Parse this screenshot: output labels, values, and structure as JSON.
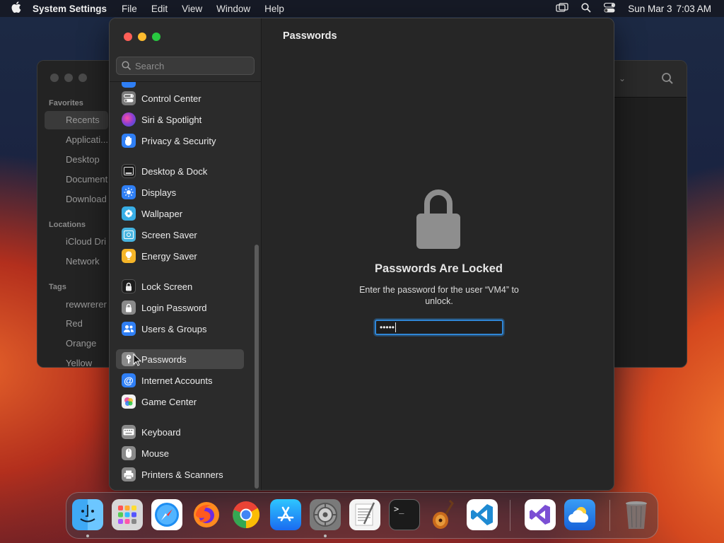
{
  "menubar": {
    "app_name": "System Settings",
    "menus": [
      "File",
      "Edit",
      "View",
      "Window",
      "Help"
    ],
    "date": "Sun Mar 3",
    "time": "7:03 AM"
  },
  "finder": {
    "sections": {
      "favorites": "Favorites",
      "locations": "Locations",
      "tags": "Tags"
    },
    "items": {
      "recents": "Recents",
      "applications": "Applicati...",
      "desktop": "Desktop",
      "documents": "Document",
      "downloads": "Download",
      "icloud": "iCloud Dri",
      "network": "Network",
      "tag1": "rewwrerer",
      "red": "Red",
      "orange": "Orange",
      "yellow": "Yellow"
    }
  },
  "settings": {
    "search": {
      "placeholder": "Search",
      "value": ""
    },
    "sidebar": [
      {
        "label": "Control Center",
        "icon": "control-center-icon",
        "color": "#7a7a7a"
      },
      {
        "label": "Siri & Spotlight",
        "icon": "siri-icon",
        "color": "#8b3fd1"
      },
      {
        "label": "Privacy & Security",
        "icon": "hand-icon",
        "color": "#2f7ff5"
      },
      {
        "label": "Desktop & Dock",
        "icon": "dock-icon",
        "color": "#1c1c1c"
      },
      {
        "label": "Displays",
        "icon": "sun-icon",
        "color": "#2f7ff5"
      },
      {
        "label": "Wallpaper",
        "icon": "flower-icon",
        "color": "#38aee6"
      },
      {
        "label": "Screen Saver",
        "icon": "screen-saver-icon",
        "color": "#47b4e0"
      },
      {
        "label": "Energy Saver",
        "icon": "bulb-icon",
        "color": "#f5b528"
      },
      {
        "label": "Lock Screen",
        "icon": "lock-icon",
        "color": "#1c1c1c"
      },
      {
        "label": "Login Password",
        "icon": "lock-icon",
        "color": "#8a8a8a"
      },
      {
        "label": "Users & Groups",
        "icon": "users-icon",
        "color": "#2f7ff5"
      },
      {
        "label": "Passwords",
        "icon": "key-icon",
        "color": "#8a8a8a"
      },
      {
        "label": "Internet Accounts",
        "icon": "at-icon",
        "color": "#2f7ff5"
      },
      {
        "label": "Game Center",
        "icon": "game-center-icon",
        "color": "#e8e8e8"
      },
      {
        "label": "Keyboard",
        "icon": "keyboard-icon",
        "color": "#8a8a8a"
      },
      {
        "label": "Mouse",
        "icon": "mouse-icon",
        "color": "#8a8a8a"
      },
      {
        "label": "Printers & Scanners",
        "icon": "printer-icon",
        "color": "#8a8a8a"
      }
    ],
    "selected": "Passwords",
    "main": {
      "title": "Passwords",
      "heading": "Passwords Are Locked",
      "message": "Enter the password for the user “VM4” to unlock.",
      "password_value": "•••••"
    }
  },
  "dock": [
    {
      "name": "Finder",
      "icon": "finder-icon",
      "running": true
    },
    {
      "name": "Launchpad",
      "icon": "launchpad-icon",
      "running": false
    },
    {
      "name": "Safari",
      "icon": "safari-icon",
      "running": false
    },
    {
      "name": "Firefox",
      "icon": "firefox-icon",
      "running": false
    },
    {
      "name": "Chrome",
      "icon": "chrome-icon",
      "running": false
    },
    {
      "name": "App Store",
      "icon": "app-store-icon",
      "running": false
    },
    {
      "name": "System Settings",
      "icon": "system-settings-icon",
      "running": true
    },
    {
      "name": "TextEdit",
      "icon": "textedit-icon",
      "running": false
    },
    {
      "name": "Terminal",
      "icon": "terminal-icon",
      "running": false
    },
    {
      "name": "GarageBand",
      "icon": "garageband-icon",
      "running": false
    },
    {
      "name": "Visual Studio Code",
      "icon": "vscode-icon",
      "running": false
    },
    {
      "name": "Visual Studio",
      "icon": "visual-studio-icon",
      "running": false
    },
    {
      "name": "Weather",
      "icon": "weather-icon",
      "running": false
    },
    {
      "name": "Trash",
      "icon": "trash-icon",
      "running": false
    }
  ]
}
